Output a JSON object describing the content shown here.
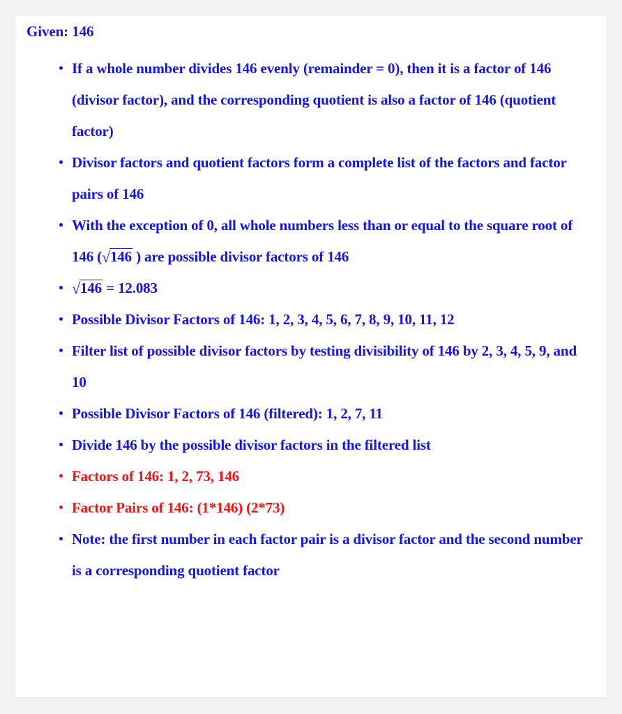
{
  "colors": {
    "page_background": "#f2f2f2",
    "card_background": "#ffffff",
    "text_blue": "#1414f0",
    "text_red": "#fa1111"
  },
  "header": {
    "given_label": "Given: 146"
  },
  "number": 146,
  "sqrt_value": "12.083",
  "bullets": [
    {
      "color": "blue",
      "text": "If a whole number divides 146 evenly (remainder = 0), then it is a factor of 146 (divisor factor), and the corresponding quotient is also a factor of 146 (quotient factor)"
    },
    {
      "color": "blue",
      "text": "Divisor factors and quotient factors form a complete list of the factors and factor pairs of 146"
    },
    {
      "color": "blue",
      "text_before": "With the exception of 0, all whole numbers less than or equal to the square root of 146 (",
      "sqrt_radicand": "146",
      "text_after": " ) are possible divisor factors of 146",
      "has_sqrt": true
    },
    {
      "color": "blue",
      "text_before": "",
      "sqrt_radicand": "146",
      "text_after": " = 12.083",
      "has_sqrt": true
    },
    {
      "color": "blue",
      "text": "Possible Divisor Factors of 146: 1, 2, 3, 4, 5, 6, 7, 8, 9, 10, 11, 12"
    },
    {
      "color": "blue",
      "text": "Filter list of possible divisor factors by testing divisibility of 146 by 2, 3, 4, 5, 9, and 10"
    },
    {
      "color": "blue",
      "text": "Possible Divisor Factors of 146 (filtered): 1, 2, 7, 11"
    },
    {
      "color": "blue",
      "text": "Divide 146 by the possible divisor factors in the filtered list"
    },
    {
      "color": "red",
      "text": "Factors of 146: 1, 2, 73, 146"
    },
    {
      "color": "red",
      "text": "Factor Pairs of 146: (1*146) (2*73)"
    },
    {
      "color": "blue",
      "text": "Note: the first number in each factor pair is a divisor factor and the second number is a corresponding quotient factor"
    }
  ]
}
